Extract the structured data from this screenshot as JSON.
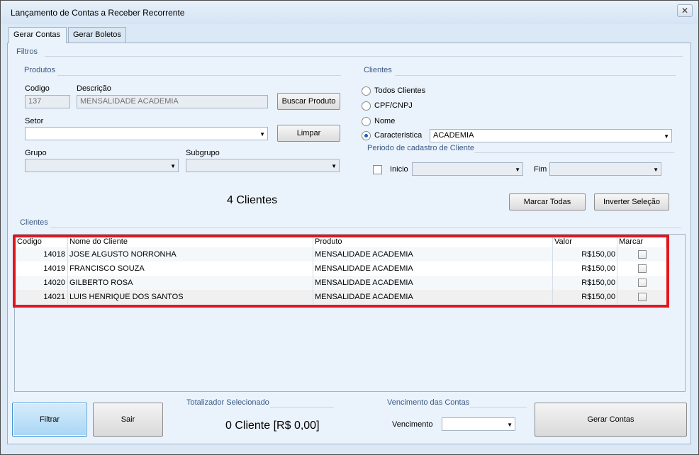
{
  "window": {
    "title": "Lançamento de Contas a Receber Recorrente",
    "close_glyph": "✕"
  },
  "tabs": [
    {
      "label": "Gerar Contas"
    },
    {
      "label": "Gerar Boletos"
    }
  ],
  "filtros": {
    "title": "Filtros",
    "produtos": {
      "title": "Produtos",
      "codigo_label": "Codigo",
      "codigo_value": "137",
      "descricao_label": "Descrição",
      "descricao_value": "MENSALIDADE ACADEMIA",
      "buscar_button": "Buscar Produto",
      "setor_label": "Setor",
      "setor_value": "",
      "limpar_button": "Limpar",
      "grupo_label": "Grupo",
      "grupo_value": "",
      "subgrupo_label": "Subgrupo",
      "subgrupo_value": ""
    },
    "clientes": {
      "title": "Clientes",
      "opt_todos": "Todos Clientes",
      "opt_cpf": "CPF/CNPJ",
      "opt_nome": "Nome",
      "opt_caracteristica": "Caracteristica",
      "caracteristica_value": "ACADEMIA",
      "periodo_title": "Periodo de cadastro de Cliente",
      "inicio_label": "Inicio",
      "inicio_value": "",
      "fim_label": "Fim",
      "fim_value": ""
    },
    "count_text": "4 Clientes",
    "marcar_todas_button": "Marcar Todas",
    "inverter_button": "Inverter Seleção"
  },
  "clientes_grid": {
    "title": "Clientes",
    "columns": {
      "codigo": "Codigo",
      "nome": "Nome do Cliente",
      "produto": "Produto",
      "valor": "Valor",
      "marcar": "Marcar"
    },
    "rows": [
      {
        "codigo": "14018",
        "nome": "JOSE ALGUSTO NORRONHA",
        "produto": "MENSALIDADE ACADEMIA",
        "valor": "R$150,00"
      },
      {
        "codigo": "14019",
        "nome": "FRANCISCO SOUZA",
        "produto": "MENSALIDADE ACADEMIA",
        "valor": "R$150,00"
      },
      {
        "codigo": "14020",
        "nome": "GILBERTO ROSA",
        "produto": "MENSALIDADE ACADEMIA",
        "valor": "R$150,00"
      },
      {
        "codigo": "14021",
        "nome": "LUIS HENRIQUE DOS SANTOS",
        "produto": "MENSALIDADE ACADEMIA",
        "valor": "R$150,00"
      }
    ]
  },
  "footer": {
    "filtrar_button": "Filtrar",
    "sair_button": "Sair",
    "totalizador_title": "Totalizador Selecionado",
    "totalizador_value": "0 Cliente [R$ 0,00]",
    "vencimento_title": "Vencimento das Contas",
    "vencimento_label": "Vencimento",
    "vencimento_value": "",
    "gerar_button": "Gerar Contas"
  },
  "colors": {
    "highlight": "#e2161c",
    "group_label": "#3b5a85",
    "panel_bg": "#eaf2fb"
  }
}
